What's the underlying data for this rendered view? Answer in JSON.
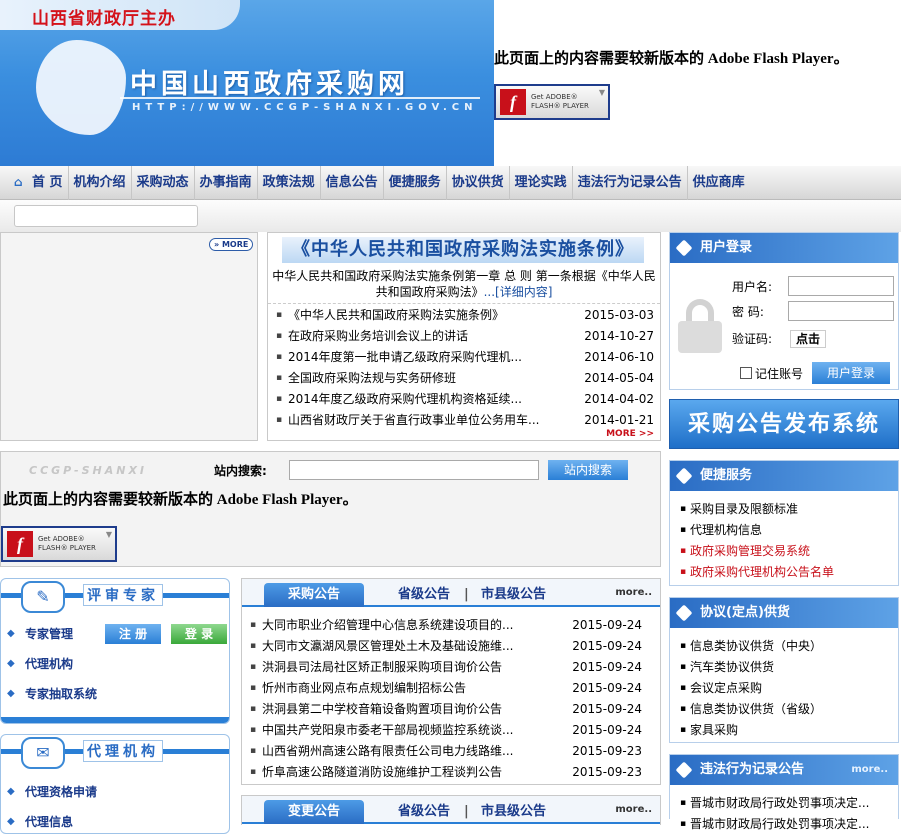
{
  "banner": {
    "sponsor": "山西省财政厅主办",
    "title": "中国山西政府采购网",
    "url": "HTTP://WWW.CCGP-SHANXI.GOV.CN"
  },
  "flash": {
    "message": "此页面上的内容需要较新版本的  Adobe Flash Player。",
    "get": "Get ADOBE®",
    "player": "FLASH® PLAYER",
    "letter": "f"
  },
  "nav": [
    "首 页",
    "机构介绍",
    "采购动态",
    "办事指南",
    "政策法规",
    "信息公告",
    "便捷服务",
    "协议供货",
    "理论实践",
    "违法行为记录公告",
    "供应商库"
  ],
  "more": "MORE",
  "law": {
    "title": "《中华人民共和国政府采购法实施条例》",
    "summary": "中华人民共和国政府采购法实施条例第一章  总  则  第一条根据《中华人民共和国政府采购法》",
    "detail": "...[详细内容]",
    "items": [
      {
        "t": "《中华人民共和国政府采购法实施条例》",
        "d": "2015-03-03"
      },
      {
        "t": "在政府采购业务培训会议上的讲话",
        "d": "2014-10-27"
      },
      {
        "t": "2014年度第一批申请乙级政府采购代理机...",
        "d": "2014-06-10"
      },
      {
        "t": "全国政府采购法规与实务研修班",
        "d": "2014-05-04"
      },
      {
        "t": "2014年度乙级政府采购代理机构资格延续...",
        "d": "2014-04-02"
      },
      {
        "t": "山西省财政厅关于省直行政事业单位公务用车...",
        "d": "2014-01-21"
      }
    ],
    "more": "MORE >>"
  },
  "search": {
    "logo": "CCGP-SHANXI",
    "label": "站内搜索:",
    "button": "站内搜索"
  },
  "login": {
    "title": "用户登录",
    "user": "用户名:",
    "pass": "密  码:",
    "code": "验证码:",
    "code_btn": "点击",
    "remember": "记住账号",
    "submit": "用户登录"
  },
  "publish": "采购公告发布系统",
  "service": {
    "title": "便捷服务",
    "items": [
      "采购目录及限额标准",
      "代理机构信息",
      "政府采购管理交易系统",
      "政府采购代理机构公告名单"
    ]
  },
  "agreement": {
    "title": "协议(定点)供货",
    "items": [
      "信息类协议供货（中央）",
      "汽车类协议供货",
      "会议定点采购",
      "信息类协议供货（省级）",
      "家具采购"
    ]
  },
  "violation": {
    "title": "违法行为记录公告",
    "more": "more..",
    "items": [
      "晋城市财政局行政处罚事项决定...",
      "晋城市财政局行政处罚事项决定..."
    ]
  },
  "expert": {
    "title": "评审专家",
    "items": [
      "专家管理",
      "代理机构",
      "专家抽取系统"
    ],
    "register": "注 册",
    "login": "登 录"
  },
  "agency": {
    "title": "代理机构",
    "items": [
      "代理资格申请",
      "代理信息"
    ]
  },
  "tabs1": {
    "on": "采购公告",
    "t2": "省级公告",
    "sep": "|",
    "t3": "市县级公告",
    "more": "more..",
    "items": [
      {
        "t": "大同市职业介绍管理中心信息系统建设项目的...",
        "d": "2015-09-24"
      },
      {
        "t": "大同市文瀛湖风景区管理处土木及基础设施维...",
        "d": "2015-09-24"
      },
      {
        "t": "洪洞县司法局社区矫正制服采购项目询价公告",
        "d": "2015-09-24"
      },
      {
        "t": "忻州市商业网点布点规划编制招标公告",
        "d": "2015-09-24"
      },
      {
        "t": "洪洞县第二中学校音箱设备购置项目询价公告",
        "d": "2015-09-24"
      },
      {
        "t": "中国共产党阳泉市委老干部局视频监控系统谈...",
        "d": "2015-09-24"
      },
      {
        "t": "山西省朔州高速公路有限责任公司电力线路维...",
        "d": "2015-09-23"
      },
      {
        "t": "忻阜高速公路隧道消防设施维护工程谈判公告",
        "d": "2015-09-23"
      }
    ]
  },
  "tabs2": {
    "on": "变更公告",
    "t2": "省级公告",
    "sep": "|",
    "t3": "市县级公告",
    "more": "more.."
  }
}
